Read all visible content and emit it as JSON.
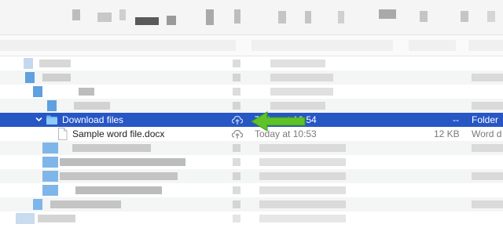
{
  "rows": {
    "folder": {
      "name": "Download files",
      "date": "Today at 10:54",
      "size": "--",
      "kind": "Folder",
      "expanded": true,
      "status_icon": "cloud-upload-icon"
    },
    "file": {
      "name": "Sample word file.docx",
      "date": "Today at 10:53",
      "size": "12 KB",
      "kind": "Word d",
      "status_icon": "cloud-upload-icon"
    }
  },
  "colors": {
    "selection": "#2756c5",
    "folder_icon": "#69b4f2",
    "arrow": "#5ec229"
  },
  "annotation": {
    "icon": "green-arrow-icon",
    "points_to": "cloud-upload-icon"
  }
}
